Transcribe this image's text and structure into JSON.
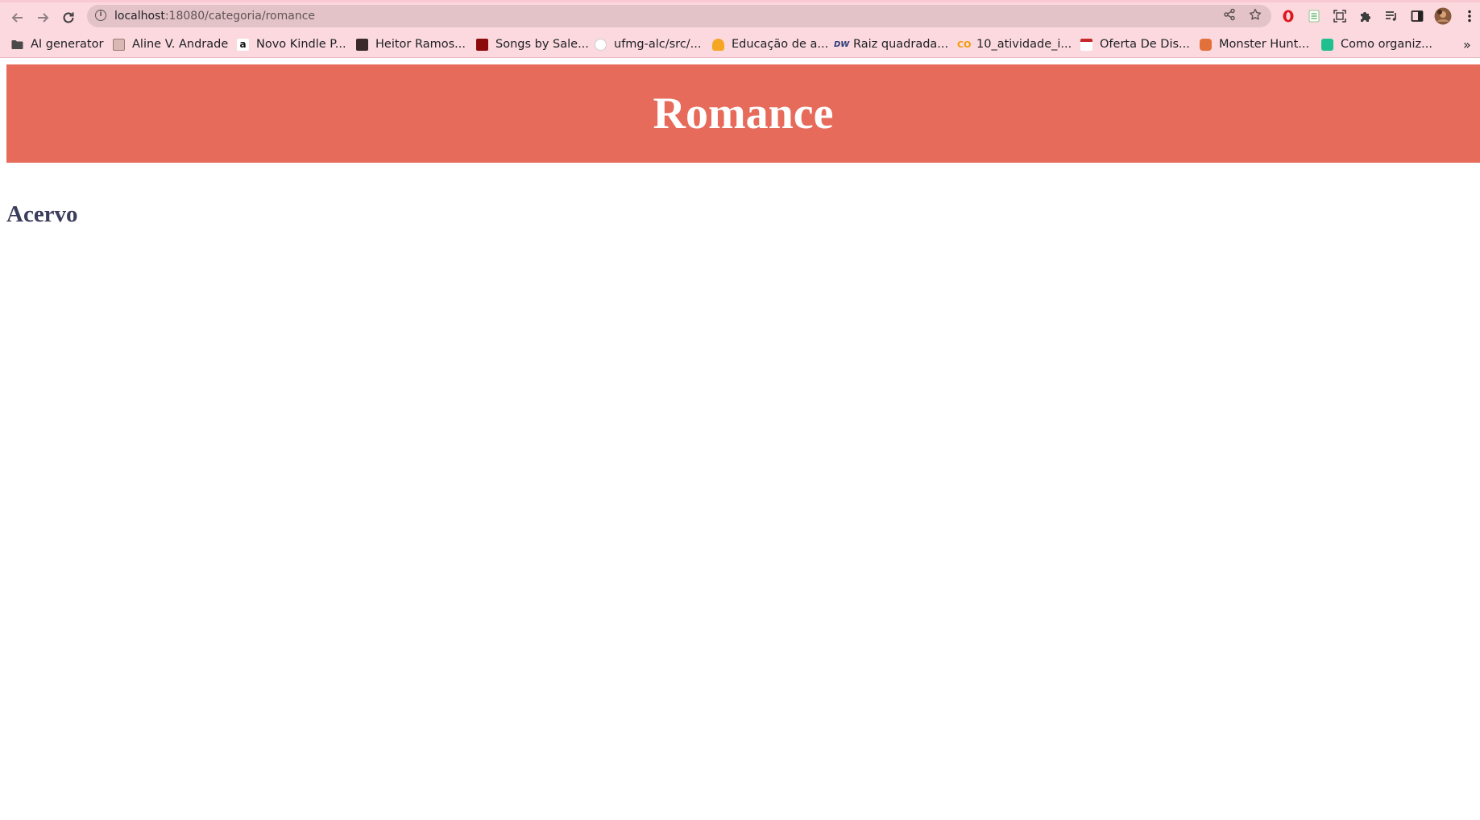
{
  "browser": {
    "url_host": "localhost",
    "url_path": ":18080/categoria/romance",
    "icons": {
      "back": "arrow-left-icon",
      "forward": "arrow-right-icon",
      "reload": "reload-icon",
      "site_info": "info-icon",
      "share": "share-icon",
      "bookmark": "star-icon"
    },
    "bookmarks": [
      {
        "label": "AI generator",
        "icon": "folder-icon"
      },
      {
        "label": "Aline V. Andrade",
        "icon": "site-favicon"
      },
      {
        "label": "Novo Kindle P...",
        "icon": "amazon-icon"
      },
      {
        "label": "Heitor Ramos...",
        "icon": "site-favicon"
      },
      {
        "label": "Songs by Sale...",
        "icon": "site-favicon"
      },
      {
        "label": "ufmg-alc/src/...",
        "icon": "github-icon"
      },
      {
        "label": "Educação de a...",
        "icon": "site-favicon"
      },
      {
        "label": "Raiz quadrada...",
        "icon": "site-favicon"
      },
      {
        "label": "10_atividade_i...",
        "icon": "colab-icon"
      },
      {
        "label": "Oferta De Dis...",
        "icon": "site-favicon"
      },
      {
        "label": "Monster Hunt...",
        "icon": "site-favicon"
      },
      {
        "label": "Como organiz...",
        "icon": "site-favicon"
      }
    ],
    "bookmarks_overflow": "»"
  },
  "page": {
    "title": "Romance",
    "section_title": "Acervo"
  },
  "colors": {
    "header_bg": "#e76b5b",
    "header_text": "#ffffff",
    "section_text": "#3b3d5c",
    "chrome_bg": "#fbd9df",
    "omnibox_bg": "#e3c3c8"
  }
}
